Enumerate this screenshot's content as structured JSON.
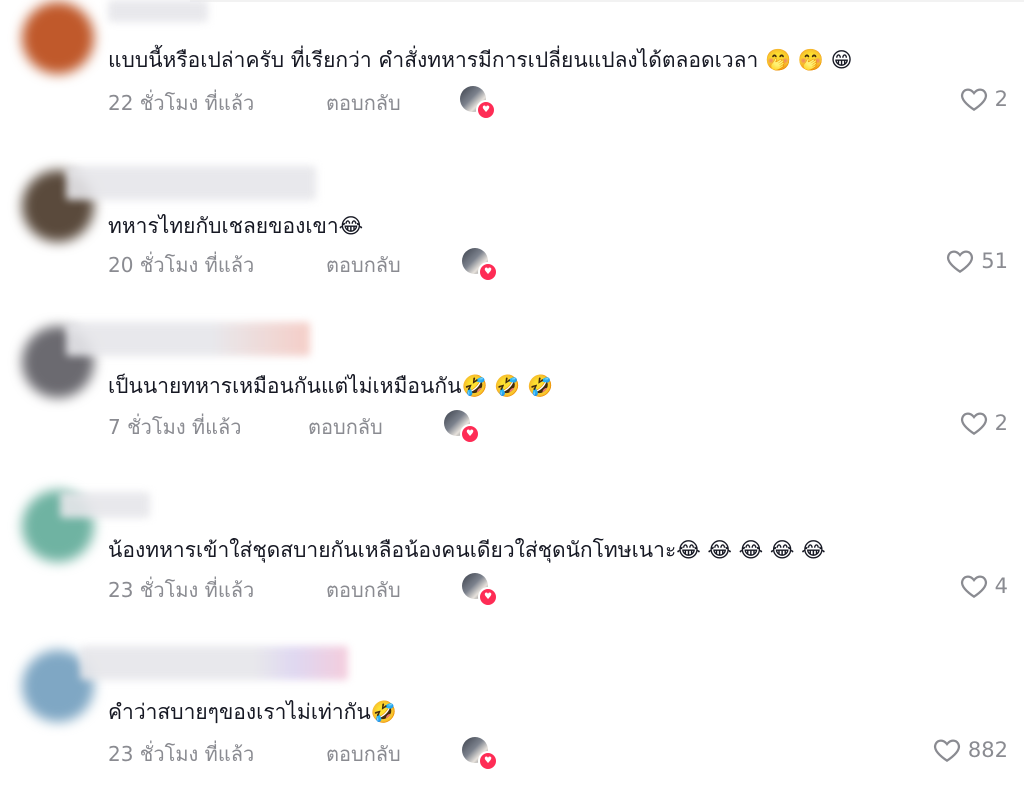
{
  "comments": [
    {
      "text": "แบบนี้หรือเปล่าครับ ที่เรียกว่า คำสั่งทหารมีการเปลี่ยนแปลงได้ตลอดเวลา 🤭 🤭 😁",
      "time": "22 ชั่วโมง ที่แล้ว",
      "reply": "ตอบกลับ",
      "likes": "2",
      "avatar_color": "#c0592b"
    },
    {
      "text": "ทหารไทยกับเชลยของเขา😂",
      "time": "20 ชั่วโมง ที่แล้ว",
      "reply": "ตอบกลับ",
      "likes": "51",
      "avatar_color": "#5a4a3c"
    },
    {
      "text": "เป็นนายทหารเหมือนกันแต่ไม่เหมือนกัน🤣 🤣 🤣",
      "time": "7 ชั่วโมง ที่แล้ว",
      "reply": "ตอบกลับ",
      "likes": "2",
      "avatar_color": "#6b6a70"
    },
    {
      "text": "น้องทหารเข้าใส่ชุดสบายกันเหลือน้องคนเดียวใส่ชุดนักโทษเนาะ😂 😂 😂 😂 😂",
      "time": "23 ชั่วโมง ที่แล้ว",
      "reply": "ตอบกลับ",
      "likes": "4",
      "avatar_color": "#6fb3a2"
    },
    {
      "text": "คำว่าสบายๆของเราไม่เท่ากัน🤣",
      "time": "23 ชั่วโมง ที่แล้ว",
      "reply": "ตอบกลับ",
      "likes": "882",
      "avatar_color": "#7fa7c4"
    }
  ],
  "colors": {
    "heart_badge": "#fe2c55",
    "meta_text": "#8a8b91",
    "body_text": "#161823"
  }
}
